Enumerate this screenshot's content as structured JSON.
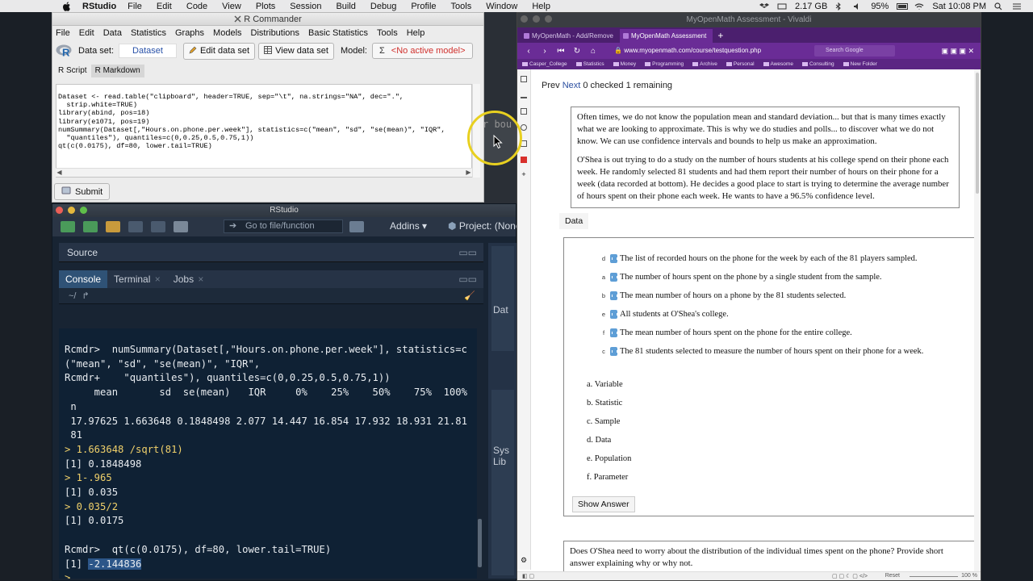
{
  "menubar": {
    "app": "RStudio",
    "items": [
      "File",
      "Edit",
      "Code",
      "View",
      "Plots",
      "Session",
      "Build",
      "Debug",
      "Profile",
      "Tools",
      "Window",
      "Help"
    ],
    "memory": "2.17 GB",
    "battery": "95%",
    "clock": "Sat 10:08 PM"
  },
  "rcmdr": {
    "title": "R Commander",
    "menu": [
      "File",
      "Edit",
      "Data",
      "Statistics",
      "Graphs",
      "Models",
      "Distributions",
      "Basic Statistics",
      "Tools",
      "Help"
    ],
    "dataset_label": "Data set:",
    "dataset_value": "Dataset",
    "edit_btn": "Edit data set",
    "view_btn": "View data set",
    "model_label": "Model:",
    "model_value": "<No active model>",
    "tabs": [
      "R Script",
      "R Markdown"
    ],
    "script": "Dataset <- read.table(\"clipboard\", header=TRUE, sep=\"\\t\", na.strings=\"NA\", dec=\".\",\n  strip.white=TRUE)\nlibrary(abind, pos=18)\nlibrary(e1071, pos=19)\nnumSummary(Dataset[,\"Hours.on.phone.per.week\"], statistics=c(\"mean\", \"sd\", \"se(mean)\", \"IQR\",\n  \"quantiles\"), quantiles=c(0,0.25,0.5,0.75,1))\nqt(c(0.0175), df=80, lower.tail=TRUE)",
    "submit": "Submit",
    "peek": "r bou"
  },
  "rstudio": {
    "title": "RStudio",
    "goto": "Go to file/function",
    "addins": "Addins",
    "project": "Project: (None",
    "source": "Source",
    "tabs": [
      "Console",
      "Terminal",
      "Jobs"
    ],
    "path": "~/",
    "right_tab_a": "Dat",
    "right_tab_b": "Sys",
    "right_tab_c": "Lib",
    "console": {
      "l1": "Rcmdr>  numSummary(Dataset[,\"Hours.on.phone.per.week\"], statistics=c",
      "l2": "(\"mean\", \"sd\", \"se(mean)\", \"IQR\",",
      "l3": "Rcmdr+    \"quantiles\"), quantiles=c(0,0.25,0.5,0.75,1))",
      "l4": "     mean       sd  se(mean)   IQR     0%    25%    50%    75%  100%",
      "l5": " n",
      "l6": " 17.97625 1.663648 0.1848498 2.077 14.447 16.854 17.932 18.931 21.81",
      "l7": " 81",
      "l8": "> 1.663648 /sqrt(81)",
      "l9": "[1] 0.1848498",
      "l10": "> 1-.965",
      "l11": "[1] 0.035",
      "l12": "> 0.035/2",
      "l13": "[1] 0.0175",
      "l14": "Rcmdr>  qt(c(0.0175), df=80, lower.tail=TRUE)",
      "l15_prefix": "[1] ",
      "l15_value": "-2.144836",
      "l16": "> "
    }
  },
  "browser": {
    "title": "MyOpenMath Assessment - Vivaldi",
    "tabs": [
      "MyOpenMath - Add/Remove",
      "MyOpenMath Assessment"
    ],
    "url": "www.myopenmath.com/course/testquestion.php",
    "search_placeholder": "Search Google",
    "bookmarks": [
      "Casper_College",
      "Statistics",
      "Money",
      "Programming",
      "Archive",
      "Personal",
      "Awesome",
      "Consulting",
      "New Folder"
    ],
    "zoom": "100 %",
    "reset": "Reset",
    "nav": {
      "prev": "Prev",
      "next": "Next",
      "status": "0 checked 1 remaining"
    },
    "question_p1": "Often times, we do not know the population mean and standard deviation... but that is many times exactly what we are looking to approximate. This is why we do studies and polls... to discover what we do not know. We can use confidence intervals and bounds to help us make an approximation.",
    "question_p2": "O'Shea is out trying to do a study on the number of hours students at his college spend on their phone each week. He randomly selected 81 students and had them report their number of hours on their phone for a week (data recorded at bottom). He decides a good place to start is trying to determine the average number of hours spent on their phone each week. He wants to have a 96.5% confidence level.",
    "data_btn": "Data",
    "matching": [
      {
        "sel": "d",
        "text": "The list of recorded hours on the phone for the week by each of the 81 players sampled."
      },
      {
        "sel": "a",
        "text": "The number of hours spent on the phone by a single student from the sample."
      },
      {
        "sel": "b",
        "text": "The mean number of hours on a phone by the 81 students selected."
      },
      {
        "sel": "e",
        "text": "All students at O'Shea's college."
      },
      {
        "sel": "f",
        "text": "The mean number of hours spent on the phone for the entire college."
      },
      {
        "sel": "c",
        "text": "The 81 students selected to measure the number of hours spent on their phone for a week."
      }
    ],
    "options": [
      "a. Variable",
      "b. Statistic",
      "c. Sample",
      "d. Data",
      "e. Population",
      "f. Parameter"
    ],
    "show_answer": "Show Answer",
    "question2": "Does O'Shea need to worry about the distribution of the individual times spent on the phone? Provide short answer explaining why or why not."
  }
}
